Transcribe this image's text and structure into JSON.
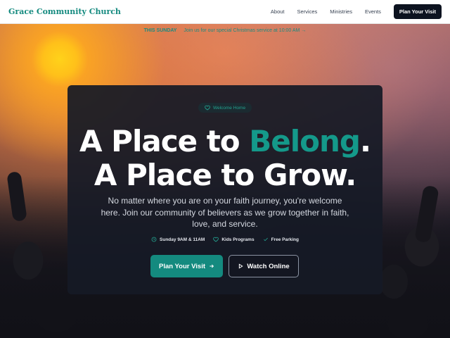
{
  "nav": {
    "brand": "Grace Community Church",
    "links": [
      "About",
      "Services",
      "Ministries",
      "Events"
    ],
    "cta": "Plan Your Visit"
  },
  "announcement": {
    "tag": "THIS SUNDAY",
    "text": "Join us for our special Christmas service at 10:00 AM"
  },
  "hero": {
    "badge": "Welcome Home",
    "headline_line1_part1": "A Place to ",
    "headline_line1_accent": "Belong",
    "headline_line1_end": ".",
    "headline_line2": "A Place to Grow.",
    "subtitle": "No matter where you are on your faith journey, you're welcome here. Join our community of believers as we grow together in faith, love, and service.",
    "features": [
      {
        "icon": "clock-icon",
        "label": "Sunday 9AM & 11AM"
      },
      {
        "icon": "heart-icon",
        "label": "Kids Programs"
      },
      {
        "icon": "check-icon",
        "label": "Free Parking"
      }
    ],
    "primary_button": "Plan Your Visit",
    "secondary_button": "Watch Online"
  },
  "colors": {
    "accent": "#148a7f",
    "dark": "#0d1320",
    "card": "#151a26"
  }
}
